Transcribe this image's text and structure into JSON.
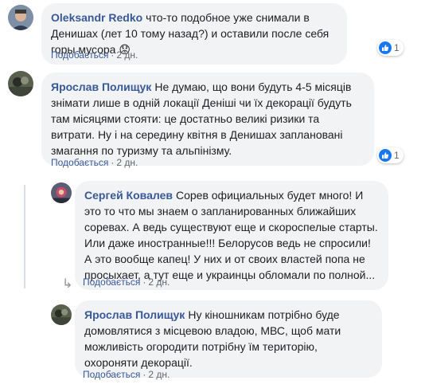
{
  "comments": [
    {
      "author": "Oleksandr Redko",
      "text": "что-то подобное уже снимали в Денишах (лет 10 тому назад?) и оставили после себя горы мусора 😟",
      "like_label": "Подобається",
      "time": "2 дн.",
      "reaction_count": "1"
    },
    {
      "author": "Ярослав Полищук",
      "text": "Не думаю, що вони будуть 4-5 місяців знімати лише в одній локації Деніші чи їх декорації будуть там місяцями стояти: це достатньо великі ризики та витрати. Ну і на середину квітня в Денишах заплановані змагання по туризму та альпінізму.",
      "like_label": "Подобається",
      "time": "2 дн.",
      "reaction_count": "1"
    },
    {
      "author": "Сергей Ковалев",
      "text": "Сорев официальных будет много! И это то что мы знаем о запланированных ближайших соревах. А ведь существуют еще и скороспелые старты. Или даже иностранные!!! Белорусов ведь не спросили! А это вообще капец! У них и от своих властей попа не просыхает, а тут еще и украинцы обломали по полной...",
      "like_label": "Подобається",
      "time": "2 дн."
    },
    {
      "author": "Ярослав Полищук",
      "text": "Ну кіношникам потрібно буде домовлятися з місцевою владою, МВС, щоб мати можливість огородити потрібну їм територію, охороняти декорації.",
      "like_label": "Подобається",
      "time": "2 дн."
    }
  ],
  "separator": "·",
  "icons": {
    "like_badge": "thumbs-up-icon",
    "reply_arrow": "reply-arrow-icon"
  },
  "colors": {
    "author": "#385898",
    "bubble": "#f2f3f5",
    "like_badge": "#1877f2"
  }
}
